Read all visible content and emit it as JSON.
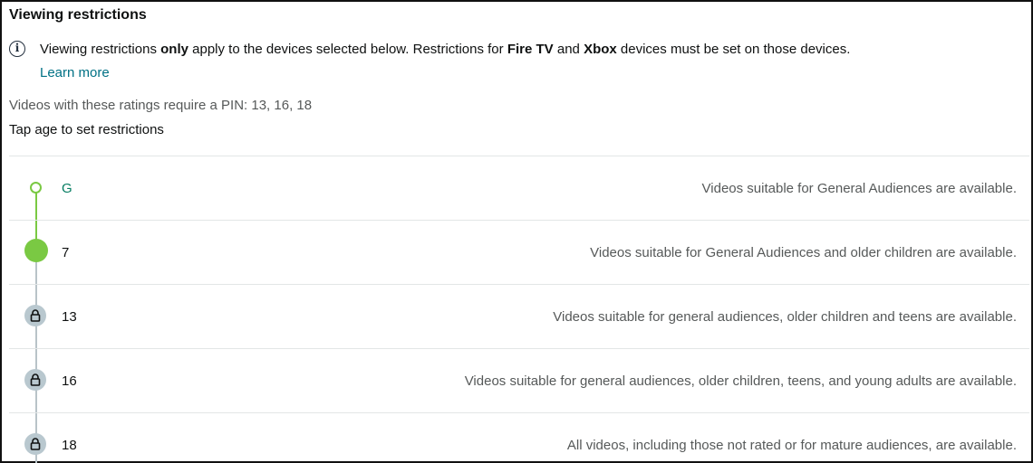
{
  "title": "Viewing restrictions",
  "notice": {
    "icon": "info-icon",
    "prefix": "Viewing restrictions ",
    "bold_only": "only",
    "middle": " apply to the devices selected below. Restrictions for ",
    "bold_fire": "Fire TV",
    "and": " and ",
    "bold_xbox": "Xbox",
    "suffix": " devices must be set on those devices.",
    "learn_more": "Learn more"
  },
  "pin_text": "Videos with these ratings require a PIN: 13, 16, 18",
  "tap_text": "Tap age to set restrictions",
  "ratings": [
    {
      "age": "G",
      "description": "Videos suitable for General Audiences are available.",
      "state": "allowed"
    },
    {
      "age": "7",
      "description": "Videos suitable for General Audiences and older children are available.",
      "state": "selected"
    },
    {
      "age": "13",
      "description": "Videos suitable for general audiences, older children and teens are available.",
      "state": "locked"
    },
    {
      "age": "16",
      "description": "Videos suitable for general audiences, older children, teens, and young adults are available.",
      "state": "locked"
    },
    {
      "age": "18",
      "description": "All videos, including those not rated or for mature audiences, are available.",
      "state": "locked"
    }
  ],
  "colors": {
    "accent_green": "#7ac943",
    "locked_grey": "#b9c8cf",
    "link": "#007185"
  }
}
